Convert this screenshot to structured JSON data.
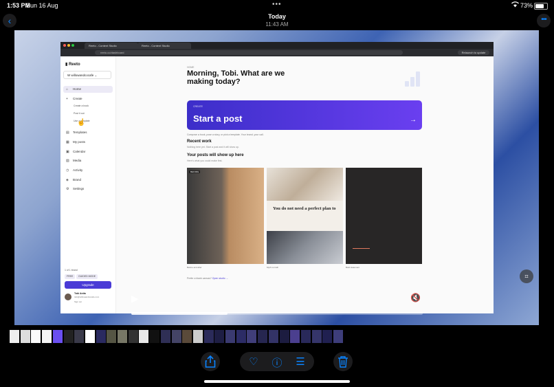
{
  "status_bar": {
    "time": "1:53 PM",
    "date": "Sun 16 Aug",
    "battery": "73%",
    "battery_level": 0.73,
    "icons": [
      "wifi-icon",
      "battery-icon"
    ]
  },
  "photos_nav": {
    "back_icon": "chevron-left-icon",
    "title": "Today",
    "subtitle": "11:43 AM",
    "more_icon": "ellipsis-icon"
  },
  "browser": {
    "tabs": [
      "Reeto - Content Studio",
      "Reeto - Content Studio"
    ],
    "url": "reeto.co/dashboard",
    "relaunch": "Relaunch to update"
  },
  "app": {
    "logo": "Reeto",
    "workspace": "willowandcocafe",
    "nav": [
      {
        "label": "Home",
        "icon": "home-icon"
      },
      {
        "label": "Create",
        "icon": "plus-icon"
      },
      {
        "label": "Templates",
        "icon": "templates-icon"
      },
      {
        "label": "My posts",
        "icon": "posts-icon"
      },
      {
        "label": "Calendar",
        "icon": "calendar-icon"
      },
      {
        "label": "Media",
        "icon": "media-icon"
      },
      {
        "label": "Activity",
        "icon": "activity-icon"
      },
      {
        "label": "Brand",
        "icon": "brand-icon"
      },
      {
        "label": "Settings",
        "icon": "settings-icon"
      }
    ],
    "create_sub": [
      "Create a book",
      "Post it out",
      "Use a template"
    ],
    "plan": "1 of 1 brand",
    "badges": [
      "FREE",
      "GUIDED MODE"
    ],
    "upgrade": "Upgrade",
    "user": {
      "name": "Tobi Anita",
      "email": "tobi@willowandcocafe.com",
      "signout": "Sign out"
    }
  },
  "main": {
    "section_label": "HOME",
    "greeting": "Morning, Tobi. What are we making today?",
    "hero": {
      "kicker": "CREATE",
      "title": "Start a post",
      "arrow": "→"
    },
    "hero_sub": "Compose a book, pose a story, or pick a template. Your brand, your call.",
    "recent_title": "Recent work",
    "recent_sub": "Nothing here yet. Start a post and it will show up.",
    "posts_title": "Your posts will show up here",
    "posts_sub": "Here's what you could make first.",
    "cards": [
      {
        "tag": "BEFORE",
        "caption": "Before and after"
      },
      {
        "text": "You do not need a perfect plan to",
        "caption": "Myth vs truth"
      },
      {
        "caption": "Bold statement"
      }
    ],
    "prefer": "Prefer a blank canvas?",
    "open_studio": "Open studio →"
  },
  "video": {
    "progress": 0.33
  },
  "toolbar": {
    "icons": [
      "share-icon",
      "heart-icon",
      "info-icon",
      "adjust-icon",
      "trash-icon"
    ]
  },
  "thumbnail_count": 31
}
